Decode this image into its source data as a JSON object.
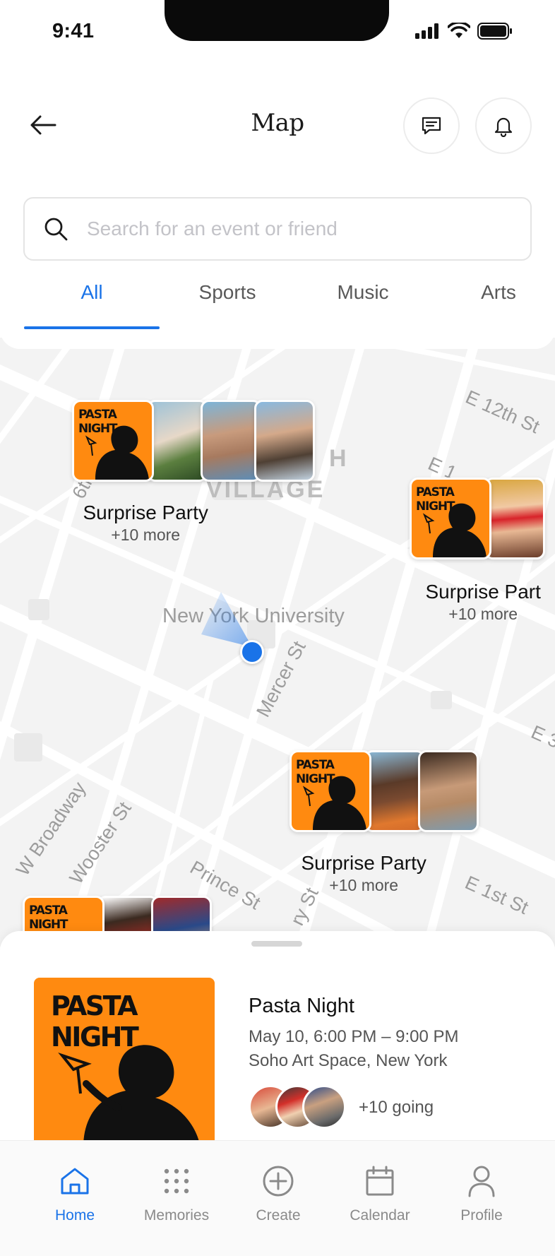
{
  "status_bar": {
    "time": "9:41"
  },
  "header": {
    "title": "Map"
  },
  "search": {
    "placeholder": "Search for an event or friend"
  },
  "tabs": [
    {
      "label": "All",
      "active": true
    },
    {
      "label": "Sports",
      "active": false
    },
    {
      "label": "Music",
      "active": false
    },
    {
      "label": "Arts",
      "active": false
    }
  ],
  "map": {
    "labels": {
      "e12th": "E 12th St",
      "village": "VILLAGE",
      "nyu": "New York University",
      "mercer": "Mercer St",
      "broadway": "W Broadway",
      "wooster": "Wooster St",
      "prince": "Prince St",
      "e1st": "E 1st St",
      "ry_st": "ry St",
      "sixth": "6th",
      "h": "H",
      "e1": "E 1",
      "e_right": "E 3"
    },
    "pins": [
      {
        "title": "Surprise Party",
        "more": "+10 more"
      },
      {
        "title": "Surprise Part",
        "more": "+10 more"
      },
      {
        "title": "Surprise Party",
        "more": "+10 more"
      }
    ],
    "poster_text": "PASTA NIGHT"
  },
  "event": {
    "poster_text": "PASTA NIGHT",
    "title": "Pasta Night",
    "date": "May 10, 6:00 PM – 9:00 PM",
    "location": "Soho Art Space, New York",
    "going": "+10 going"
  },
  "nav": {
    "home": "Home",
    "memories": "Memories",
    "create": "Create",
    "calendar": "Calendar",
    "profile": "Profile"
  },
  "colors": {
    "accent": "#1a73e8",
    "poster": "#ff8a10"
  }
}
